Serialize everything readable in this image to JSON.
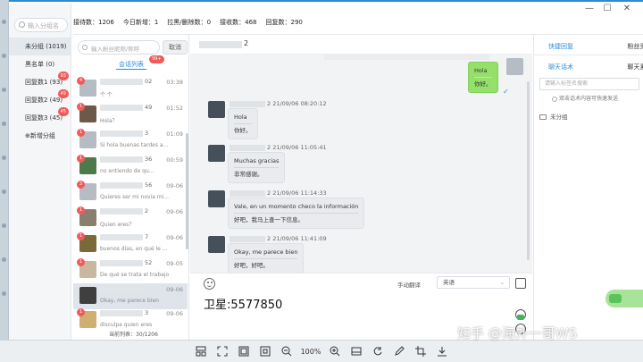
{
  "window": {
    "minimize": "—",
    "maximize": "☐",
    "close": "✕"
  },
  "sidebar": {
    "search_placeholder": "输入分组名",
    "groups": [
      {
        "label": "未分组 (1019)",
        "badge": ""
      },
      {
        "label": "黑名单 (0)",
        "badge": ""
      },
      {
        "label": "回复数1 (93)",
        "badge": "93"
      },
      {
        "label": "回复数2 (49)",
        "badge": "49"
      },
      {
        "label": "回复数3 (45)",
        "badge": "45"
      },
      {
        "label": "⊕新增分组",
        "badge": ""
      }
    ]
  },
  "stats": {
    "items": [
      "接待数：1206",
      "今日新增：1",
      "拉黑/删除数：0",
      "接收数：468",
      "回复数：290"
    ]
  },
  "sessions": {
    "search_placeholder": "输入粉丝昵称/称呼",
    "cancel": "取消",
    "tab_label": "会话列表",
    "tab_badge": "99+",
    "footer": "当前列表：30/1206",
    "items": [
      {
        "badge": "4",
        "name_tail": "02",
        "time": "03:38",
        "preview": "个 个",
        "avatar": "#b6bcc3"
      },
      {
        "badge": "1",
        "name_tail": "49",
        "time": "01:52",
        "preview": "Hola？",
        "avatar": "#6b5a4a"
      },
      {
        "badge": "1",
        "name_tail": "3",
        "time": "01:09",
        "preview": "Si hola buenas tardes a...",
        "avatar": "#b6bcc3"
      },
      {
        "badge": "1",
        "name_tail": "36",
        "time": "00:59",
        "preview": "no entiendo de qu...",
        "avatar": "#4c7a4a"
      },
      {
        "badge": "3",
        "name_tail": "56",
        "time": "09-06",
        "preview": "Quieres ser mi novia mi...",
        "avatar": "#b6bcc3"
      },
      {
        "badge": "1",
        "name_tail": "2",
        "time": "09-06",
        "preview": "Quien eres？",
        "avatar": "#8a7f6e"
      },
      {
        "badge": "1",
        "name_tail": "7",
        "time": "09-06",
        "preview": "buenos días, en qué le ...",
        "avatar": "#7a6a3a"
      },
      {
        "badge": "1",
        "name_tail": "52",
        "time": "09-05",
        "preview": "De qué se trata el trabajo",
        "avatar": "#c9b7a0"
      },
      {
        "badge": "",
        "name_tail": "",
        "time": "09-06",
        "preview": "Okay, me parece bien",
        "avatar": "#3f3f3f"
      },
      {
        "badge": "1",
        "name_tail": "3",
        "time": "09-06",
        "preview": "disculpa quien eres",
        "avatar": "#d0b070"
      }
    ]
  },
  "chat": {
    "header_tail": "2",
    "messages": [
      {
        "meta": "2  21/09/06 08:20:12",
        "lines": [
          "Hola",
          "你好。"
        ]
      },
      {
        "meta": "2  21/09/06 11:05:41",
        "lines": [
          "Muchas gracias",
          "非常感谢。"
        ]
      },
      {
        "meta": "2  21/09/06 11:14:33",
        "lines": [
          "Vale, en un momento checo la información",
          "好吧，我马上查一下信息。"
        ]
      },
      {
        "meta": "2  21/09/06 11:41:09",
        "lines": [
          "Okay, me parece bien",
          "好吧，好吧。"
        ]
      }
    ],
    "my_message": {
      "lines": [
        "Hola",
        "你好。"
      ]
    },
    "translate_label": "手动翻译",
    "lang": "英语",
    "typed_text": "卫星:5577850"
  },
  "right_panel": {
    "tabs": [
      "快捷回复",
      "粉丝资",
      "聊天话术",
      "聊天素"
    ],
    "search_placeholder": "请输入标签名搜索",
    "checkbox_label": "双击话术内容可快速发送",
    "group_label": "未分组"
  },
  "toolbar": {
    "zoom": "100%"
  },
  "watermark": "知乎 @海外一哥WS",
  "colors": {
    "accent": "#2b8ad6",
    "badge": "#f25a5a",
    "my_bubble": "#95e06a"
  }
}
